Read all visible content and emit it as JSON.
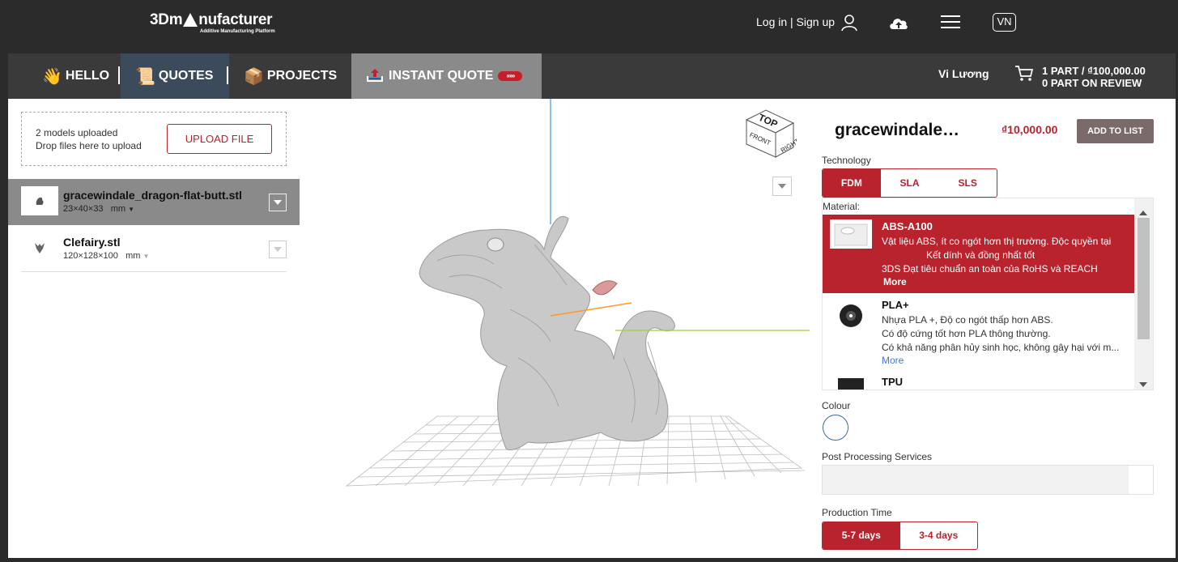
{
  "header": {
    "logo_main_1": "3Dm",
    "logo_main_2": "nufacturer",
    "logo_sub": "Additive Manufacturing Platform",
    "login_label": "Log in | Sign up",
    "lang_label": "VN",
    "icons": [
      "user-icon",
      "cloud-upload-icon",
      "hamburger-menu-icon"
    ]
  },
  "nav": {
    "hello": "HELLO",
    "quotes": "QUOTES",
    "projects": "PROJECTS",
    "instant_quote": "INSTANT QUOTE",
    "user_name": "Vi Lương",
    "cart_line1": "1 PART / ₫100,000.00",
    "cart_line2": "0 PART ON REVIEW"
  },
  "upload": {
    "info_line1": "2 models uploaded",
    "info_line2": "Drop files here to upload",
    "button": "UPLOAD FILE"
  },
  "files": [
    {
      "name": "gracewindale_dragon-flat-butt.stl",
      "dims": "23×40×33",
      "unit": "mm",
      "active": true
    },
    {
      "name": "Clefairy.stl",
      "dims": "120×128×100",
      "unit": "mm",
      "active": false
    }
  ],
  "viewer": {
    "cube_top": "TOP",
    "cube_front": "FRONT",
    "cube_right": "RIGHT"
  },
  "panel": {
    "title": "gracewindale…",
    "price": "₫10,000.00",
    "add_button": "ADD TO LIST",
    "technology_label": "Technology",
    "technologies": [
      "FDM",
      "SLA",
      "SLS"
    ],
    "selected_technology": "FDM",
    "material_label": "Material:",
    "materials": [
      {
        "name": "ABS-A100",
        "desc1": "Vật liệu ABS, ít co ngót hơn thị trường. Độc quyền tại",
        "desc2": "Kết dính và đồng nhất tốt",
        "desc3": "3DS Đạt tiêu chuẩn an toàn của RoHS và REACH",
        "more": "More"
      },
      {
        "name": "PLA+",
        "desc1": "Nhựa PLA +, Độ co ngót thấp hơn ABS.",
        "desc2": "Có độ cứng tốt hơn PLA thông thường.",
        "desc3": "Có khả năng phân hủy sinh học, không gây hại với m...",
        "more": "More"
      },
      {
        "name": "TPU"
      }
    ],
    "colour_label": "Colour",
    "post_label": "Post Processing Services",
    "time_label": "Production Time",
    "times": [
      "5-7 days",
      "3-4 days"
    ],
    "selected_time": "5-7 days"
  },
  "colors": {
    "brand_red": "#b8232d",
    "nav_bg": "#3a3a3a",
    "top_bg": "#2b2b2b",
    "quotes_bg": "#3b4b5c",
    "instant_bg": "#8a8a8a"
  }
}
